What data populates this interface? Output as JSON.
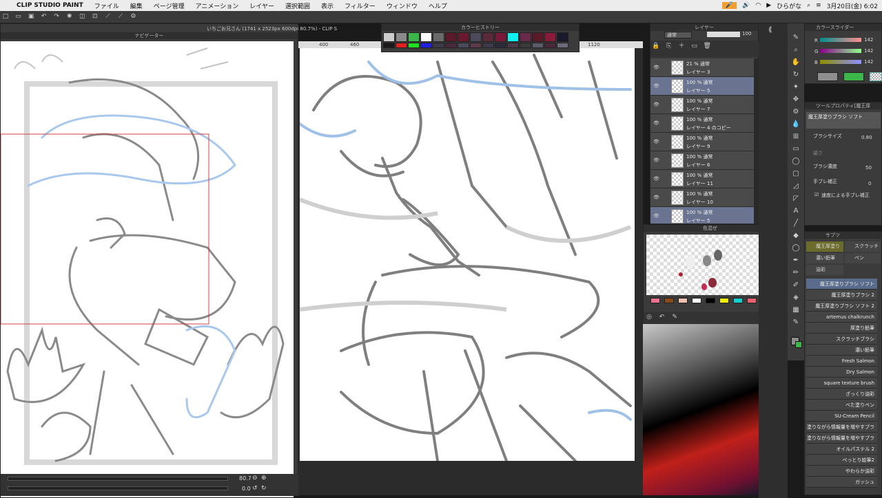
{
  "menubar": {
    "app": "CLIP STUDIO PAINT",
    "items": [
      "ファイル",
      "編集",
      "ページ管理",
      "アニメーション",
      "レイヤー",
      "選択範囲",
      "表示",
      "フィルター",
      "ウィンドウ",
      "ヘルプ"
    ],
    "input_mode": "ひらがな",
    "datetime": "3月20日(金) 6:02"
  },
  "navigator": {
    "title": "ナビゲーター",
    "zoom": "80.7",
    "rotation": "0.0"
  },
  "canvas_window": {
    "title": "いちごお兄さん (1741 x 2523px 600dpi 80.7%) - CLIP S",
    "ruler": [
      "400",
      "460",
      "1120"
    ]
  },
  "color_history": {
    "title": "カラーヒストリー"
  },
  "layers": {
    "title": "レイヤー",
    "blend": "通常",
    "opacity": "100",
    "rows": [
      {
        "pct": "21 % 通常",
        "name": "レイヤー 3"
      },
      {
        "pct": "100 % 通常",
        "name": "レイヤー 5"
      },
      {
        "pct": "100 % 通常",
        "name": "レイヤー 7"
      },
      {
        "pct": "100 % 通常",
        "name": "レイヤー 4 のコピー"
      },
      {
        "pct": "100 % 通常",
        "name": "レイヤー 9"
      },
      {
        "pct": "100 % 通常",
        "name": "レイヤー 6"
      },
      {
        "pct": "100 % 通常",
        "name": "レイヤー 11"
      },
      {
        "pct": "100 % 通常",
        "name": "レイヤー 10"
      },
      {
        "pct": "100 % 通常",
        "name": "レイヤー 5"
      }
    ]
  },
  "color_mix": {
    "title": "色混ぜ"
  },
  "color_slider": {
    "title": "カラースライダー",
    "r": "142",
    "g": "142",
    "b": "142",
    "labels": [
      "R",
      "G",
      "B"
    ]
  },
  "tool_property": {
    "title": "ツールプロパティ[魔王厚",
    "tool_name": "魔王厚塗りブラシ ソフト",
    "size_label": "ブラシサイズ",
    "size": "0.80",
    "density_label": "ブラシ濃度",
    "density": "50",
    "stabilize_label": "手ブレ補正",
    "stabilize": "0",
    "speed_label": "速度による手ブレ補正",
    "misc_label": "硬さ"
  },
  "subtool": {
    "title": "サブツ",
    "groups": [
      "魔王厚塗り",
      "スクラッチ",
      "濃い鉛筆",
      "ペン",
      "油彩"
    ],
    "brushes": [
      "魔王厚塗りブラシ ソフト",
      "魔王厚塗りブラシ 2",
      "魔王厚塗りブラシ ソフト 2",
      "artemus chalkrunch",
      "厚塗り鉛筆",
      "スクラッチブラシ",
      "濃い鉛筆",
      "Fresh Salmon",
      "Dry Salmon",
      "square texture brush",
      "ざっくり油彩",
      "べた塗りペン",
      "SU-Cream Pencil",
      "塗りながら情報量を増やすブラ",
      "塗りながら情報量を増やすブラ",
      "オイルパステル 2",
      "べっとり絵筆2",
      "やわらか油彩",
      "ガッシュ"
    ]
  },
  "colors": {
    "accent": "#5b6b8b",
    "sketch": "#888888",
    "blue": "#9fc1e8"
  }
}
